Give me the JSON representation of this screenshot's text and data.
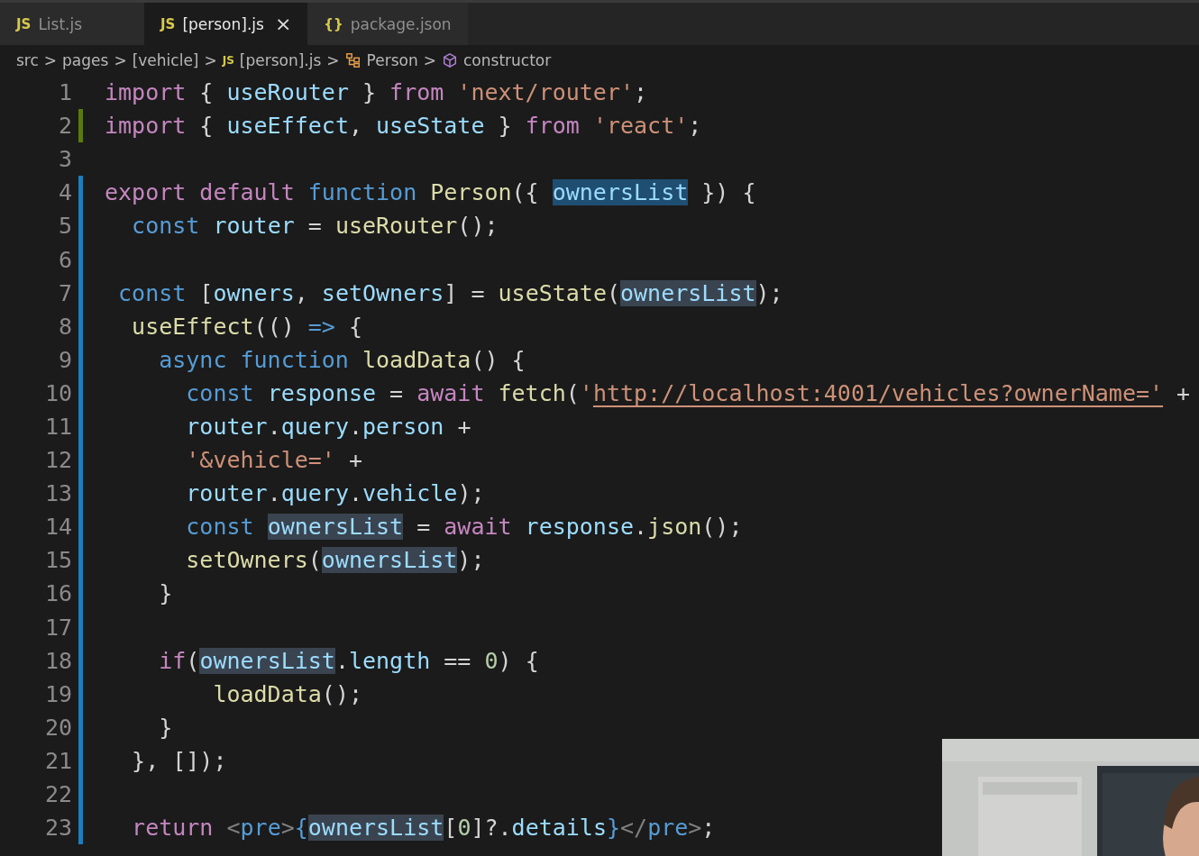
{
  "tabs": [
    {
      "label": "List.js",
      "icon": "JS",
      "selected": false
    },
    {
      "label": "[person].js",
      "icon": "JS",
      "selected": true,
      "close": "×"
    },
    {
      "label": "package.json",
      "icon": "{}",
      "selected": false
    }
  ],
  "breadcrumb": [
    {
      "label": "src",
      "kind": "folder"
    },
    {
      "label": "pages",
      "kind": "folder"
    },
    {
      "label": "[vehicle]",
      "kind": "folder"
    },
    {
      "label": "[person].js",
      "kind": "file",
      "icon": "JS"
    },
    {
      "label": "Person",
      "kind": "class"
    },
    {
      "label": "constructor",
      "kind": "method"
    }
  ],
  "separator": ">",
  "lines": [
    {
      "number": "1",
      "kind": "plain",
      "tokens": [
        {
          "text": "import",
          "kind": "ctrl"
        },
        {
          "text": " { ",
          "kind": "punct"
        },
        {
          "text": "useRouter",
          "kind": "var"
        },
        {
          "text": " } ",
          "kind": "punct"
        },
        {
          "text": "from ",
          "kind": "ctrl"
        },
        {
          "text": "'next/router'",
          "kind": "str"
        },
        {
          "text": ";",
          "kind": "punct"
        }
      ]
    },
    {
      "number": "2",
      "kind": "added",
      "tokens": [
        {
          "text": "import",
          "kind": "ctrl"
        },
        {
          "text": " { ",
          "kind": "punct"
        },
        {
          "text": "useEffect",
          "kind": "var"
        },
        {
          "text": ", ",
          "kind": "punct"
        },
        {
          "text": "useState",
          "kind": "var"
        },
        {
          "text": " } ",
          "kind": "punct"
        },
        {
          "text": "from ",
          "kind": "ctrl"
        },
        {
          "text": "'react'",
          "kind": "str"
        },
        {
          "text": ";",
          "kind": "punct"
        }
      ]
    },
    {
      "number": "3",
      "kind": "plain"
    },
    {
      "number": "4",
      "kind": "modified",
      "tokens": [
        {
          "text": "export default ",
          "kind": "ctrl"
        },
        {
          "text": "function ",
          "kind": "storage"
        },
        {
          "text": "Person",
          "kind": "fn"
        },
        {
          "text": "({ ",
          "kind": "punct"
        },
        {
          "text": "ownersList",
          "kind": "focus"
        },
        {
          "text": " }) {",
          "kind": "punct"
        }
      ]
    },
    {
      "number": "5",
      "kind": "modified",
      "tokens": [
        {
          "text": "  const ",
          "kind": "storage"
        },
        {
          "text": "router",
          "kind": "var"
        },
        {
          "text": " = ",
          "kind": "punct"
        },
        {
          "text": "useRouter",
          "kind": "fn"
        },
        {
          "text": "();",
          "kind": "punct"
        }
      ]
    },
    {
      "number": "6",
      "kind": "modified"
    },
    {
      "number": "7",
      "kind": "modified",
      "tokens": [
        {
          "text": " const",
          "kind": "storage"
        },
        {
          "text": " [",
          "kind": "punct"
        },
        {
          "text": "owners",
          "kind": "var"
        },
        {
          "text": ", ",
          "kind": "punct"
        },
        {
          "text": "setOwners",
          "kind": "var"
        },
        {
          "text": "] = ",
          "kind": "punct"
        },
        {
          "text": "useState",
          "kind": "fn"
        },
        {
          "text": "(",
          "kind": "punct"
        },
        {
          "text": "ownersList",
          "kind": "match"
        },
        {
          "text": ");",
          "kind": "punct"
        }
      ]
    },
    {
      "number": "8",
      "kind": "modified",
      "tokens": [
        {
          "text": "  useEffect",
          "kind": "fn"
        },
        {
          "text": "(() ",
          "kind": "punct"
        },
        {
          "text": "=>",
          "kind": "storage"
        },
        {
          "text": " {",
          "kind": "punct"
        }
      ]
    },
    {
      "number": "9",
      "kind": "modified",
      "tokens": [
        {
          "text": "    async function ",
          "kind": "storage"
        },
        {
          "text": "loadData",
          "kind": "fn"
        },
        {
          "text": "() {",
          "kind": "punct"
        }
      ]
    },
    {
      "number": "10",
      "kind": "modified",
      "tokens": [
        {
          "text": "      const ",
          "kind": "storage"
        },
        {
          "text": "response",
          "kind": "var"
        },
        {
          "text": " = ",
          "kind": "punct"
        },
        {
          "text": "await ",
          "kind": "ctrl"
        },
        {
          "text": "fetch",
          "kind": "fn"
        },
        {
          "text": "(",
          "kind": "punct"
        },
        {
          "text": "'",
          "kind": "str"
        },
        {
          "text": "http://localhost:4001/vehicles?ownerName='",
          "kind": "link"
        },
        {
          "text": " +",
          "kind": "punct"
        }
      ]
    },
    {
      "number": "11",
      "kind": "modified",
      "tokens": [
        {
          "text": "      router",
          "kind": "var"
        },
        {
          "text": ".",
          "kind": "punct"
        },
        {
          "text": "query",
          "kind": "var"
        },
        {
          "text": ".",
          "kind": "punct"
        },
        {
          "text": "person",
          "kind": "var"
        },
        {
          "text": " +",
          "kind": "punct"
        }
      ]
    },
    {
      "number": "12",
      "kind": "modified",
      "tokens": [
        {
          "text": "      '&vehicle='",
          "kind": "str"
        },
        {
          "text": " +",
          "kind": "punct"
        }
      ]
    },
    {
      "number": "13",
      "kind": "modified",
      "tokens": [
        {
          "text": "      router",
          "kind": "var"
        },
        {
          "text": ".",
          "kind": "punct"
        },
        {
          "text": "query",
          "kind": "var"
        },
        {
          "text": ".",
          "kind": "punct"
        },
        {
          "text": "vehicle",
          "kind": "var"
        },
        {
          "text": ");",
          "kind": "punct"
        }
      ]
    },
    {
      "number": "14",
      "kind": "modified",
      "tokens": [
        {
          "text": "      const ",
          "kind": "storage"
        },
        {
          "text": "ownersList",
          "kind": "match"
        },
        {
          "text": " = ",
          "kind": "punct"
        },
        {
          "text": "await ",
          "kind": "ctrl"
        },
        {
          "text": "response",
          "kind": "var"
        },
        {
          "text": ".",
          "kind": "punct"
        },
        {
          "text": "json",
          "kind": "fn"
        },
        {
          "text": "();",
          "kind": "punct"
        }
      ]
    },
    {
      "number": "15",
      "kind": "modified",
      "tokens": [
        {
          "text": "      setOwners",
          "kind": "fn"
        },
        {
          "text": "(",
          "kind": "punct"
        },
        {
          "text": "ownersList",
          "kind": "match"
        },
        {
          "text": ");",
          "kind": "punct"
        }
      ]
    },
    {
      "number": "16",
      "kind": "modified",
      "tokens": [
        {
          "text": "    }",
          "kind": "punct"
        }
      ]
    },
    {
      "number": "17",
      "kind": "modified"
    },
    {
      "number": "18",
      "kind": "modified",
      "tokens": [
        {
          "text": "    if",
          "kind": "ctrl"
        },
        {
          "text": "(",
          "kind": "punct"
        },
        {
          "text": "ownersList",
          "kind": "match"
        },
        {
          "text": ".",
          "kind": "punct"
        },
        {
          "text": "length",
          "kind": "var"
        },
        {
          "text": " == ",
          "kind": "punct"
        },
        {
          "text": "0",
          "kind": "num"
        },
        {
          "text": ") {",
          "kind": "punct"
        }
      ]
    },
    {
      "number": "19",
      "kind": "modified",
      "tokens": [
        {
          "text": "        loadData",
          "kind": "fn"
        },
        {
          "text": "();",
          "kind": "punct"
        }
      ]
    },
    {
      "number": "20",
      "kind": "modified",
      "tokens": [
        {
          "text": "    }",
          "kind": "punct"
        }
      ]
    },
    {
      "number": "21",
      "kind": "modified",
      "tokens": [
        {
          "text": "  }, []);",
          "kind": "punct"
        }
      ]
    },
    {
      "number": "22",
      "kind": "modified"
    },
    {
      "number": "23",
      "kind": "modified",
      "tokens": [
        {
          "text": "  return ",
          "kind": "ctrl"
        },
        {
          "text": "<",
          "kind": "tagpunct"
        },
        {
          "text": "pre",
          "kind": "tag"
        },
        {
          "text": ">",
          "kind": "tagpunct"
        },
        {
          "text": "{",
          "kind": "storage"
        },
        {
          "text": "ownersList",
          "kind": "match"
        },
        {
          "text": "[",
          "kind": "punct"
        },
        {
          "text": "0",
          "kind": "num"
        },
        {
          "text": "]?.",
          "kind": "punct"
        },
        {
          "text": "details",
          "kind": "var"
        },
        {
          "text": "}",
          "kind": "storage"
        },
        {
          "text": "</",
          "kind": "tagpunct"
        },
        {
          "text": "pre",
          "kind": "tag"
        },
        {
          "text": ">",
          "kind": "tagpunct"
        },
        {
          "text": ";",
          "kind": "punct"
        }
      ]
    }
  ]
}
